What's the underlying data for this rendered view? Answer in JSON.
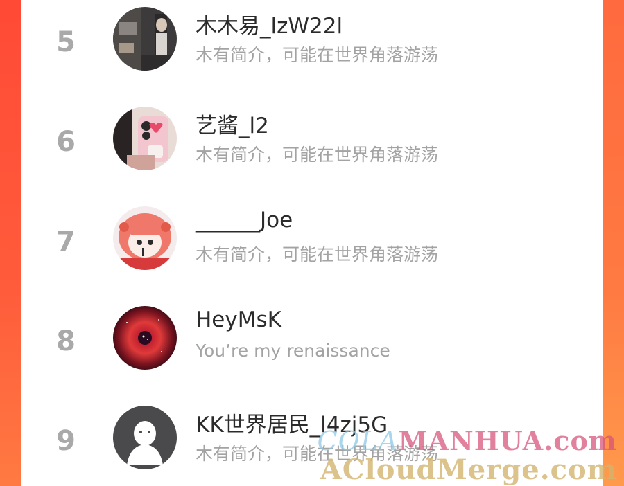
{
  "users": [
    {
      "rank": "5",
      "name": "木木易_lzW22l",
      "bio": "木有简介，可能在世界角落游荡",
      "avatar_icon": "photo-avatar-dark-room"
    },
    {
      "rank": "6",
      "name": "艺酱_l2",
      "bio": "木有简介，可能在世界角落游荡",
      "avatar_icon": "photo-avatar-phone-case"
    },
    {
      "rank": "7",
      "name": "______Joe",
      "bio": "木有简介，可能在世界角落游荡",
      "avatar_icon": "anime-girl-avatar"
    },
    {
      "rank": "8",
      "name": "HeyMsK",
      "bio": "You’re my renaissance",
      "avatar_icon": "nebula-avatar"
    },
    {
      "rank": "9",
      "name": "KK世界居民_l4zj5G",
      "bio": "木有简介，可能在世界角落游荡",
      "avatar_icon": "default-ghost-avatar"
    }
  ],
  "watermark": {
    "line1_prefix": "COLA",
    "line1_suffix": "MANHUA.com",
    "line2": "ACloudMerge.com"
  },
  "colors": {
    "rank": "#a9a9a9",
    "name": "#2b2b2b",
    "bio": "#a3a3a3",
    "frame": "#ff5a3a"
  }
}
